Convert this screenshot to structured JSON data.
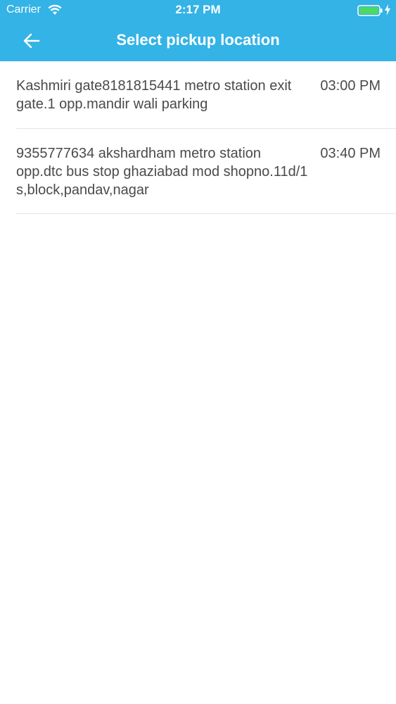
{
  "status_bar": {
    "carrier": "Carrier",
    "time": "2:17 PM",
    "icons": [
      "wifi-icon",
      "battery-icon",
      "charging-bolt-icon"
    ]
  },
  "header": {
    "title": "Select pickup location",
    "back_icon": "back-arrow-icon",
    "color": "#33b3e6"
  },
  "locations": [
    {
      "address": "Kashmiri gate8181815441 metro station exit gate.1 opp.mandir wali parking",
      "time": "03:00 PM"
    },
    {
      "address": "9355777634 akshardham metro station opp.dtc bus stop ghaziabad mod shopno.11d/1 s,block,pandav,nagar",
      "time": "03:40 PM"
    }
  ]
}
